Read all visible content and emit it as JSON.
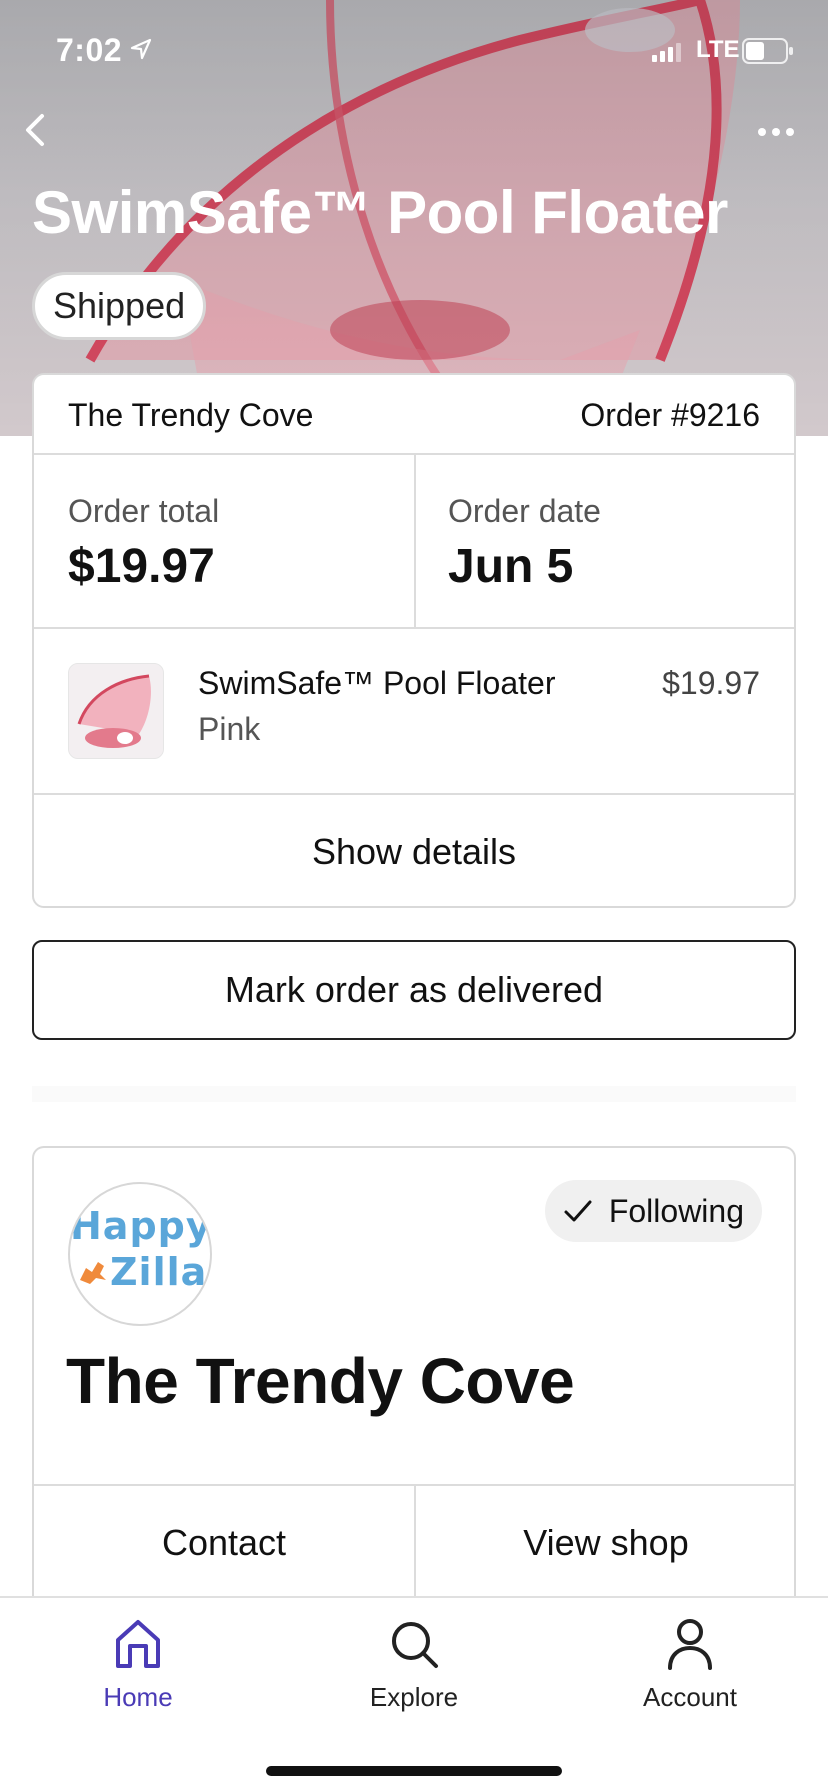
{
  "status_bar": {
    "time": "7:02",
    "network": "LTE",
    "icons": [
      "location-arrow-icon",
      "signal-bars-icon",
      "battery-icon"
    ]
  },
  "header": {
    "back_icon": "chevron-left-icon",
    "more_icon": "ellipsis-icon",
    "product_title": "SwimSafe™ Pool Floater",
    "status": "Shipped"
  },
  "order": {
    "shop_name": "The Trendy Cove",
    "order_number": "Order #9216",
    "total_label": "Order total",
    "total_value": "$19.97",
    "date_label": "Order date",
    "date_value": "Jun 5",
    "item": {
      "name": "SwimSafe™ Pool Floater",
      "variant": "Pink",
      "price": "$19.97"
    },
    "details_label": "Show details"
  },
  "deliver_label": "Mark order as delivered",
  "shop": {
    "logo_text_line1": "Happy",
    "logo_text_line2": "Zilla",
    "following_label": "Following",
    "name": "The Trendy Cove",
    "contact_label": "Contact",
    "view_shop_label": "View shop"
  },
  "tabs": [
    {
      "label": "Home",
      "icon": "home-icon",
      "active": true
    },
    {
      "label": "Explore",
      "icon": "search-icon",
      "active": false
    },
    {
      "label": "Account",
      "icon": "person-icon",
      "active": false
    }
  ],
  "colors": {
    "accent": "#4a3bb6",
    "logo_blue": "#5aa6d9",
    "product_pink": "#e0566e"
  }
}
